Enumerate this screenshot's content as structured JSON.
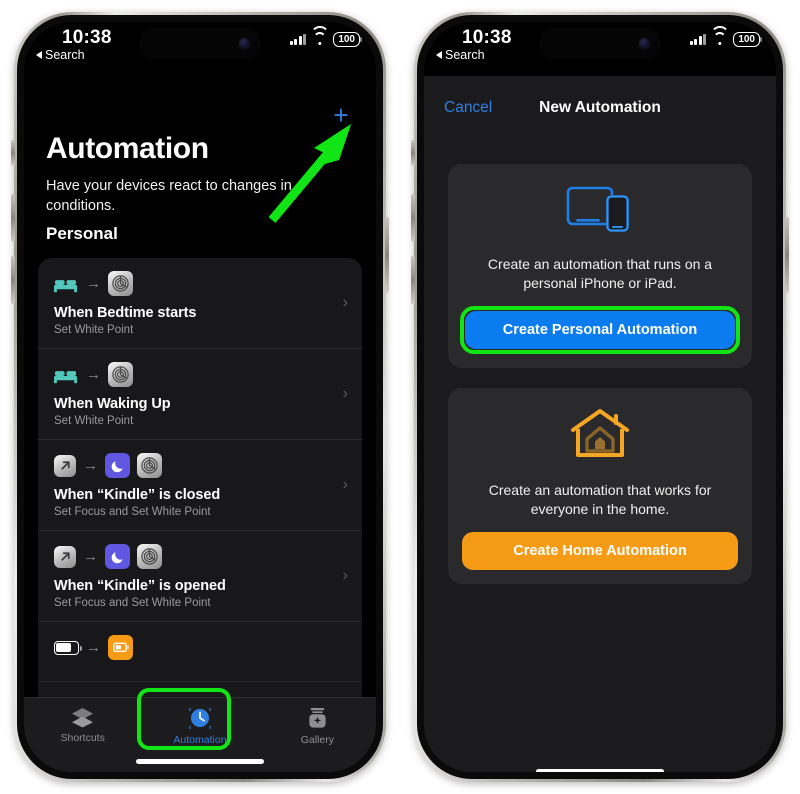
{
  "screenshot": {
    "background": "#ffffff",
    "accent_blue": "#2f7fe0",
    "accent_orange": "#f59b16",
    "highlight_green": "#12e515",
    "card_bg": "#18181a"
  },
  "phone1": {
    "status_bar": {
      "time": "10:38",
      "back_label": "Search",
      "cellular_icon": "signal-bars-icon",
      "wifi_icon": "wifi-icon",
      "battery_level": "100"
    },
    "add_button_icon": "plus-icon",
    "title": "Automation",
    "subtitle": "Have your devices react to changes in conditions.",
    "section_header": "Personal",
    "automations": [
      {
        "trigger_icon": "bed-icon",
        "action_icons": [
          "white-point-app-icon"
        ],
        "title": "When Bedtime starts",
        "subtitle": "Set White Point",
        "chevron_icon": "chevron-right-icon"
      },
      {
        "trigger_icon": "bed-icon",
        "action_icons": [
          "white-point-app-icon"
        ],
        "title": "When Waking Up",
        "subtitle": "Set White Point",
        "chevron_icon": "chevron-right-icon"
      },
      {
        "trigger_icon": "app-open-icon",
        "action_icons": [
          "focus-moon-icon",
          "white-point-app-icon"
        ],
        "title": "When “Kindle” is closed",
        "subtitle": "Set Focus and Set White Point",
        "chevron_icon": "chevron-right-icon"
      },
      {
        "trigger_icon": "app-open-icon",
        "action_icons": [
          "focus-moon-icon",
          "white-point-app-icon"
        ],
        "title": "When “Kindle” is opened",
        "subtitle": "Set Focus and Set White Point",
        "chevron_icon": "chevron-right-icon"
      },
      {
        "trigger_icon": "battery-icon",
        "action_icons": [
          "low-power-mode-icon"
        ],
        "title": "",
        "subtitle": "",
        "chevron_icon": "chevron-right-icon"
      }
    ],
    "tabs": [
      {
        "label": "Shortcuts",
        "icon": "stacked-layers-icon",
        "active": false
      },
      {
        "label": "Automation",
        "icon": "automation-clock-icon",
        "active": true
      },
      {
        "label": "Gallery",
        "icon": "gallery-jar-icon",
        "active": false
      }
    ],
    "annotations": {
      "arrow": "green-arrow-pointing-to-plus-button",
      "tab_highlight": "green-box-around-automation-tab"
    }
  },
  "phone2": {
    "status_bar": {
      "time": "10:38",
      "back_label": "Search",
      "cellular_icon": "signal-bars-icon",
      "wifi_icon": "wifi-icon",
      "battery_level": "100"
    },
    "nav": {
      "cancel_label": "Cancel",
      "title": "New Automation"
    },
    "options": [
      {
        "icon": "ipad-iphone-devices-icon",
        "description": "Create an automation that runs on a personal iPhone or iPad.",
        "button_label": "Create Personal Automation",
        "button_color": "#0a7cf0",
        "highlighted": true
      },
      {
        "icon": "home-house-icon",
        "description": "Create an automation that works for everyone in the home.",
        "button_label": "Create Home Automation",
        "button_color": "#f59b16",
        "highlighted": false
      }
    ]
  }
}
